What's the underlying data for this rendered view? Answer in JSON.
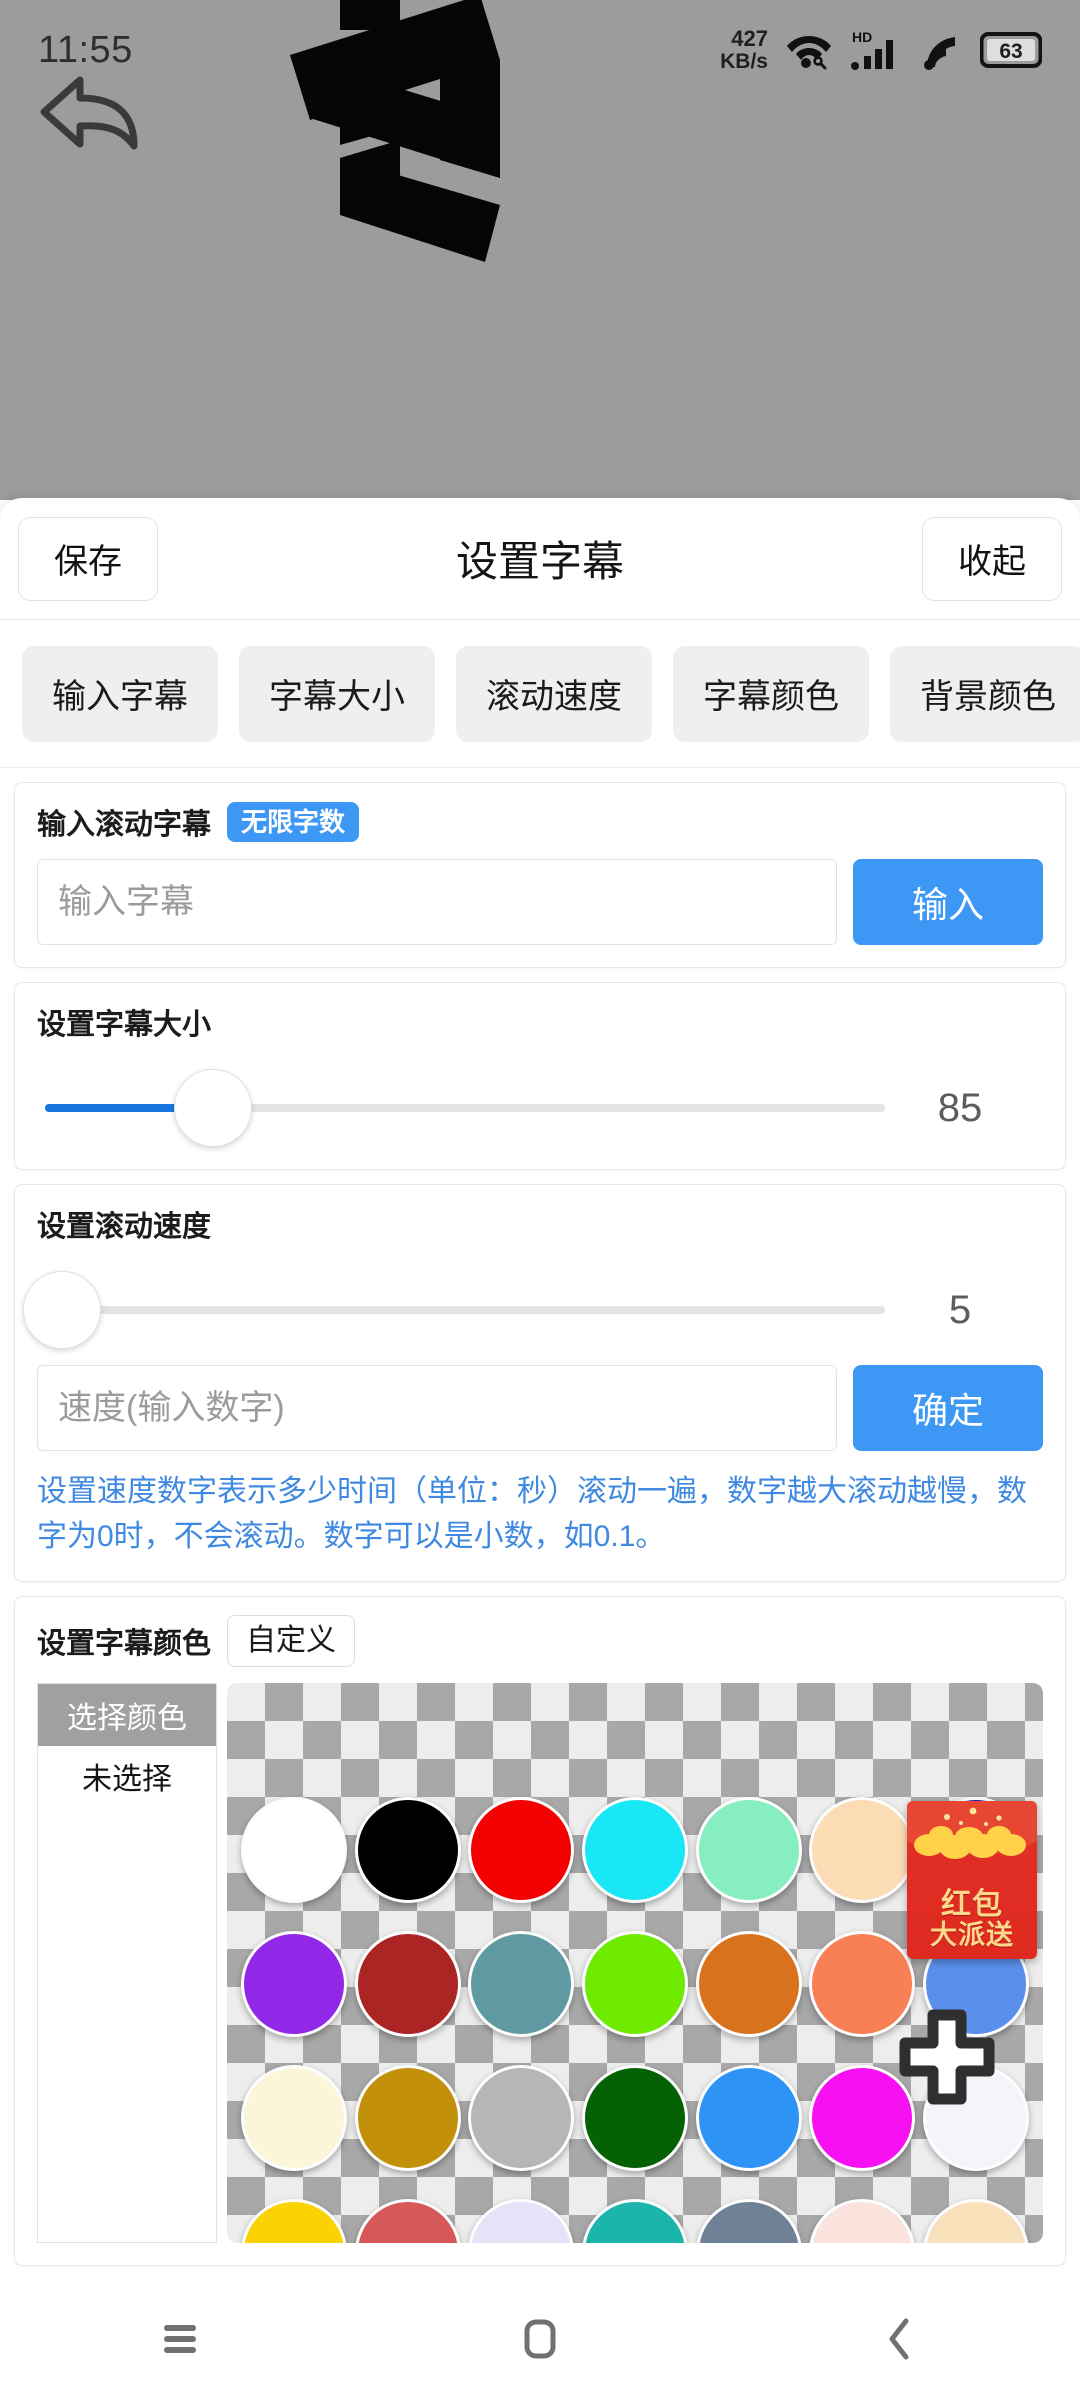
{
  "status_bar": {
    "time": "11:55",
    "net_speed_value": "427",
    "net_speed_unit": "KB/s",
    "wifi_icon": "wifi-icon",
    "hd_label": "HD",
    "signal_icon": "cellular-signal-icon",
    "cast_icon": "cast-icon",
    "battery_level": "63"
  },
  "preview": {
    "back_icon": "reply-back-arrow-icon",
    "marquee_glyphs": [
      "<",
      ">"
    ]
  },
  "header": {
    "save_label": "保存",
    "title": "设置字幕",
    "collapse_label": "收起"
  },
  "tabs": [
    {
      "label": "输入字幕"
    },
    {
      "label": "字幕大小"
    },
    {
      "label": "滚动速度"
    },
    {
      "label": "字幕颜色"
    },
    {
      "label": "背景颜色"
    }
  ],
  "input_card": {
    "label": "输入滚动字幕",
    "badge": "无限字数",
    "placeholder": "输入字幕",
    "value": "",
    "button": "输入"
  },
  "size_card": {
    "label": "设置字幕大小",
    "value": "85",
    "percent": 20,
    "fill_color": "#1775e0"
  },
  "speed_card": {
    "label": "设置滚动速度",
    "value": "5",
    "percent": 2,
    "placeholder": "速度(输入数字)",
    "input_value": "",
    "button": "确定",
    "hint": "设置速度数字表示多少时间（单位：秒）滚动一遍，数字越大滚动越慢，数字为0时，不会滚动。数字可以是小数，如0.1。",
    "hint_color": "#3f8ae0"
  },
  "color_card": {
    "label": "设置字幕颜色",
    "custom_button": "自定义",
    "list_header": "选择颜色",
    "list_item": "未选择",
    "swatches": [
      {
        "name": "white",
        "hex": "#ffffff"
      },
      {
        "name": "black",
        "hex": "#000000"
      },
      {
        "name": "red",
        "hex": "#f40000"
      },
      {
        "name": "cyan",
        "hex": "#1ae7f5"
      },
      {
        "name": "aquamarine",
        "hex": "#86eec1"
      },
      {
        "name": "peach-puff",
        "hex": "#fbdcb4"
      },
      {
        "name": "blue",
        "hex": "#0a12d2"
      },
      {
        "name": "purple",
        "hex": "#9327e8"
      },
      {
        "name": "firebrick",
        "hex": "#ab2525"
      },
      {
        "name": "cadet-blue",
        "hex": "#5f9aa2"
      },
      {
        "name": "chartreuse",
        "hex": "#6eeb00"
      },
      {
        "name": "chocolate",
        "hex": "#d8721d"
      },
      {
        "name": "coral",
        "hex": "#f98055"
      },
      {
        "name": "cornflower-blue",
        "hex": "#5a8fec"
      },
      {
        "name": "ivory",
        "hex": "#fbf5d9"
      },
      {
        "name": "dark-goldenrod",
        "hex": "#c2900a"
      },
      {
        "name": "silver",
        "hex": "#b6b6b6"
      },
      {
        "name": "dark-green",
        "hex": "#046104"
      },
      {
        "name": "dodger-blue",
        "hex": "#2d93f5"
      },
      {
        "name": "magenta",
        "hex": "#f711f2"
      },
      {
        "name": "ghost-white",
        "hex": "#f4f5fb"
      },
      {
        "name": "gold",
        "hex": "#fcd302"
      },
      {
        "name": "indian-red",
        "hex": "#d65858"
      },
      {
        "name": "lavender",
        "hex": "#e4e3f7"
      },
      {
        "name": "light-sea-green",
        "hex": "#1bb5ab"
      },
      {
        "name": "slate-gray",
        "hex": "#6f8195"
      },
      {
        "name": "misty-rose",
        "hex": "#fbe3dd"
      },
      {
        "name": "wheat",
        "hex": "#f8e0bb"
      }
    ],
    "ad": {
      "line1": "红包",
      "line2": "大派送"
    },
    "plus_icon": "plus-widget-icon"
  },
  "nav_bar": {
    "menu_icon": "menu-icon",
    "home_icon": "home-icon",
    "back_icon": "back-chevron-icon"
  }
}
